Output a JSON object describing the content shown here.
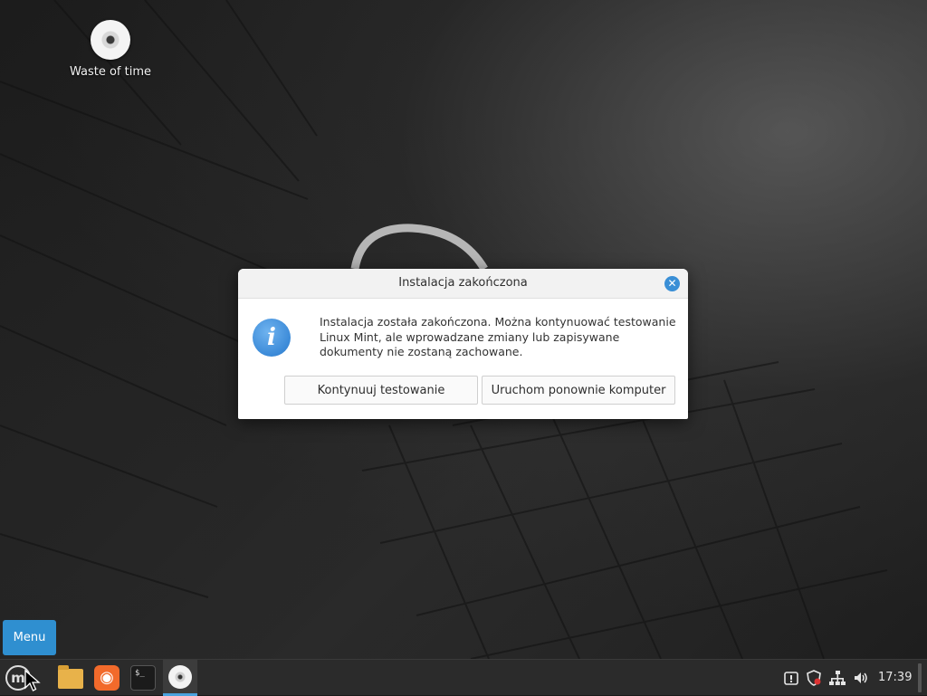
{
  "desktop": {
    "icons": [
      {
        "label": "Waste of time",
        "icon": "disc-icon"
      }
    ]
  },
  "dialog": {
    "title": "Instalacja zakończona",
    "close_icon": "close-icon",
    "icon": "info-icon",
    "message": "Instalacja została zakończona. Można kontynuować testowanie Linux Mint, ale wprowadzane zmiany lub zapisywane dokumenty nie zostaną zachowane.",
    "buttons": {
      "continue_label": "Kontynuuj testowanie",
      "restart_label": "Uruchom ponownie komputer"
    },
    "accent_color": "#3a8fd6"
  },
  "menu_popup": {
    "label": "Menu"
  },
  "taskbar": {
    "launchers": [
      {
        "name": "mint-menu",
        "icon": "linux-mint-logo-icon"
      },
      {
        "name": "files",
        "icon": "folder-icon"
      },
      {
        "name": "firefox",
        "icon": "firefox-icon"
      },
      {
        "name": "terminal",
        "icon": "terminal-icon",
        "glyph": "$_"
      },
      {
        "name": "installer",
        "icon": "disc-icon",
        "active": true
      }
    ],
    "tray": {
      "icons": [
        "update-manager-icon",
        "shield-icon",
        "network-icon",
        "volume-icon"
      ],
      "clock": "17:39"
    },
    "accent_color": "#4aa3df"
  }
}
